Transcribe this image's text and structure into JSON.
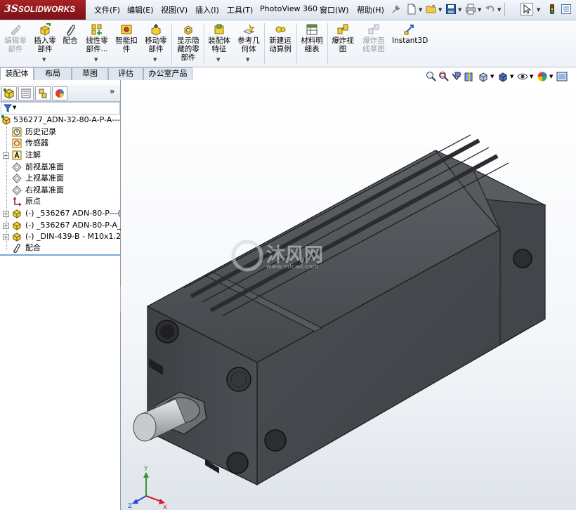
{
  "app": {
    "logo_ds": "3S",
    "logo_name": "SOLIDWORKS",
    "menus": [
      "文件(F)",
      "编辑(E)",
      "视图(V)",
      "插入(I)",
      "工具(T)",
      "PhotoView 360",
      "窗口(W)",
      "帮助(H)"
    ]
  },
  "commands": {
    "edit_part": [
      "编辑零",
      "部件"
    ],
    "insert_part": [
      "插入零",
      "部件"
    ],
    "mate": [
      "配合"
    ],
    "linear_pattern": [
      "线性零",
      "部件..."
    ],
    "smart_fastener": [
      "智能扣",
      "件"
    ],
    "move_part": [
      "移动零",
      "部件"
    ],
    "show_hidden": [
      "显示隐",
      "藏的零",
      "部件"
    ],
    "assembly_feature": [
      "装配体",
      "特征"
    ],
    "reference_geometry": [
      "参考几",
      "何体"
    ],
    "new_motion_study": [
      "新建运",
      "动算例"
    ],
    "bom": [
      "材料明",
      "细表"
    ],
    "exploded_view": [
      "爆炸视",
      "图"
    ],
    "explode_line": [
      "爆炸直",
      "线草图"
    ],
    "instant3d": [
      "Instant3D"
    ]
  },
  "tabs": [
    "装配体",
    "布局",
    "草图",
    "评估",
    "办公室产品"
  ],
  "active_tab": "装配体",
  "tree": {
    "root": "536277_ADN-32-80-A-P-A---",
    "items": [
      {
        "label": "历史记录",
        "icon": "history-icon",
        "expand": false
      },
      {
        "label": "传感器",
        "icon": "sensor-icon",
        "expand": false
      },
      {
        "label": "注解",
        "icon": "annotation-icon",
        "expand": true
      },
      {
        "label": "前视基准面",
        "icon": "plane-icon",
        "expand": false
      },
      {
        "label": "上视基准面",
        "icon": "plane-icon",
        "expand": false
      },
      {
        "label": "右视基准面",
        "icon": "plane-icon",
        "expand": false
      },
      {
        "label": "原点",
        "icon": "origin-icon",
        "expand": false
      },
      {
        "label": "(-) _536267 ADN-80-P---(",
        "icon": "part-icon",
        "expand": true
      },
      {
        "label": "(-) _536267 ADN-80-P-A_",
        "icon": "part-icon",
        "expand": true
      },
      {
        "label": "(-) _DIN-439-B - M10x1.2",
        "icon": "part-icon",
        "expand": true
      },
      {
        "label": "配合",
        "icon": "mates-icon",
        "expand": false
      }
    ]
  },
  "viewport": {
    "watermark_brand": "沐风网",
    "watermark_url": "www.mfcad.com",
    "triad": {
      "x": "X",
      "y": "Y",
      "z": "Z"
    }
  },
  "colors": {
    "accent": "#a62226",
    "body": "#4a4c50",
    "edge": "#1a1a1a"
  }
}
